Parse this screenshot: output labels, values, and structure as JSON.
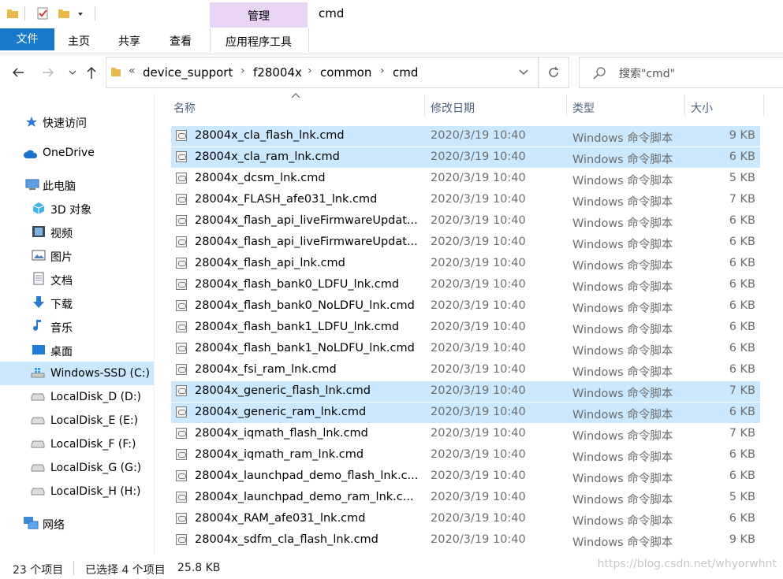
{
  "quick_access_toolbar": {
    "icons": [
      "folder-icon",
      "properties-icon",
      "new-folder-icon",
      "customize-dropdown-icon"
    ]
  },
  "ribbon": {
    "context_group": "管理",
    "window_title": "cmd",
    "tabs": [
      {
        "label": "文件",
        "active": true
      },
      {
        "label": "主页"
      },
      {
        "label": "共享"
      },
      {
        "label": "查看"
      }
    ],
    "context_tab": "应用程序工具"
  },
  "address_bar": {
    "overflow": "«",
    "breadcrumbs": [
      "device_support",
      "f28004x",
      "common",
      "cmd"
    ]
  },
  "search": {
    "placeholder": "搜索\"cmd\""
  },
  "nav_pane": {
    "items": [
      {
        "label": "快速访问",
        "icon": "star-icon"
      },
      {
        "label": "OneDrive",
        "icon": "cloud-icon"
      },
      {
        "label": "此电脑",
        "icon": "computer-icon"
      },
      {
        "label": "3D 对象",
        "icon": "cube-icon"
      },
      {
        "label": "视频",
        "icon": "video-icon"
      },
      {
        "label": "图片",
        "icon": "picture-icon"
      },
      {
        "label": "文档",
        "icon": "document-icon"
      },
      {
        "label": "下载",
        "icon": "download-icon"
      },
      {
        "label": "音乐",
        "icon": "music-icon"
      },
      {
        "label": "桌面",
        "icon": "desktop-icon"
      },
      {
        "label": "Windows-SSD (C:)",
        "icon": "windows-drive-icon",
        "selected": true
      },
      {
        "label": "LocalDisk_D (D:)",
        "icon": "drive-icon"
      },
      {
        "label": "LocalDisk_E (E:)",
        "icon": "drive-icon"
      },
      {
        "label": "LocalDisk_F (F:)",
        "icon": "drive-icon"
      },
      {
        "label": "LocalDisk_G (G:)",
        "icon": "drive-icon"
      },
      {
        "label": "LocalDisk_H (H:)",
        "icon": "drive-icon"
      },
      {
        "label": "网络",
        "icon": "network-icon"
      }
    ]
  },
  "columns": {
    "name": "名称",
    "date": "修改日期",
    "type": "类型",
    "size": "大小"
  },
  "files": [
    {
      "name": "28004x_cla_flash_lnk.cmd",
      "date": "2020/3/19 10:40",
      "type": "Windows 命令脚本",
      "size": "9 KB",
      "selected": true
    },
    {
      "name": "28004x_cla_ram_lnk.cmd",
      "date": "2020/3/19 10:40",
      "type": "Windows 命令脚本",
      "size": "6 KB",
      "selected": true
    },
    {
      "name": "28004x_dcsm_lnk.cmd",
      "date": "2020/3/19 10:40",
      "type": "Windows 命令脚本",
      "size": "5 KB"
    },
    {
      "name": "28004x_FLASH_afe031_lnk.cmd",
      "date": "2020/3/19 10:40",
      "type": "Windows 命令脚本",
      "size": "7 KB"
    },
    {
      "name": "28004x_flash_api_liveFirmwareUpdat...",
      "date": "2020/3/19 10:40",
      "type": "Windows 命令脚本",
      "size": "6 KB"
    },
    {
      "name": "28004x_flash_api_liveFirmwareUpdat...",
      "date": "2020/3/19 10:40",
      "type": "Windows 命令脚本",
      "size": "6 KB"
    },
    {
      "name": "28004x_flash_api_lnk.cmd",
      "date": "2020/3/19 10:40",
      "type": "Windows 命令脚本",
      "size": "6 KB"
    },
    {
      "name": "28004x_flash_bank0_LDFU_lnk.cmd",
      "date": "2020/3/19 10:40",
      "type": "Windows 命令脚本",
      "size": "6 KB"
    },
    {
      "name": "28004x_flash_bank0_NoLDFU_lnk.cmd",
      "date": "2020/3/19 10:40",
      "type": "Windows 命令脚本",
      "size": "6 KB"
    },
    {
      "name": "28004x_flash_bank1_LDFU_lnk.cmd",
      "date": "2020/3/19 10:40",
      "type": "Windows 命令脚本",
      "size": "6 KB"
    },
    {
      "name": "28004x_flash_bank1_NoLDFU_lnk.cmd",
      "date": "2020/3/19 10:40",
      "type": "Windows 命令脚本",
      "size": "6 KB"
    },
    {
      "name": "28004x_fsi_ram_lnk.cmd",
      "date": "2020/3/19 10:40",
      "type": "Windows 命令脚本",
      "size": "6 KB"
    },
    {
      "name": "28004x_generic_flash_lnk.cmd",
      "date": "2020/3/19 10:40",
      "type": "Windows 命令脚本",
      "size": "7 KB",
      "selected": true
    },
    {
      "name": "28004x_generic_ram_lnk.cmd",
      "date": "2020/3/19 10:40",
      "type": "Windows 命令脚本",
      "size": "6 KB",
      "selected": true
    },
    {
      "name": "28004x_iqmath_flash_lnk.cmd",
      "date": "2020/3/19 10:40",
      "type": "Windows 命令脚本",
      "size": "7 KB"
    },
    {
      "name": "28004x_iqmath_ram_lnk.cmd",
      "date": "2020/3/19 10:40",
      "type": "Windows 命令脚本",
      "size": "6 KB"
    },
    {
      "name": "28004x_launchpad_demo_flash_lnk.c...",
      "date": "2020/3/19 10:40",
      "type": "Windows 命令脚本",
      "size": "6 KB"
    },
    {
      "name": "28004x_launchpad_demo_ram_lnk.c...",
      "date": "2020/3/19 10:40",
      "type": "Windows 命令脚本",
      "size": "5 KB"
    },
    {
      "name": "28004x_RAM_afe031_lnk.cmd",
      "date": "2020/3/19 10:40",
      "type": "Windows 命令脚本",
      "size": "6 KB"
    },
    {
      "name": "28004x_sdfm_cla_flash_lnk.cmd",
      "date": "2020/3/19 10:40",
      "type": "Windows 命令脚本",
      "size": "9 KB"
    }
  ],
  "status_bar": {
    "item_count": "23 个项目",
    "selection": "已选择 4 个项目",
    "selection_size": "25.8 KB"
  },
  "watermark": "https://blog.csdn.net/whyorwhnt",
  "colors": {
    "accent": "#1979ca",
    "selection": "#cce8ff",
    "context_tab": "#e8d4f3"
  }
}
